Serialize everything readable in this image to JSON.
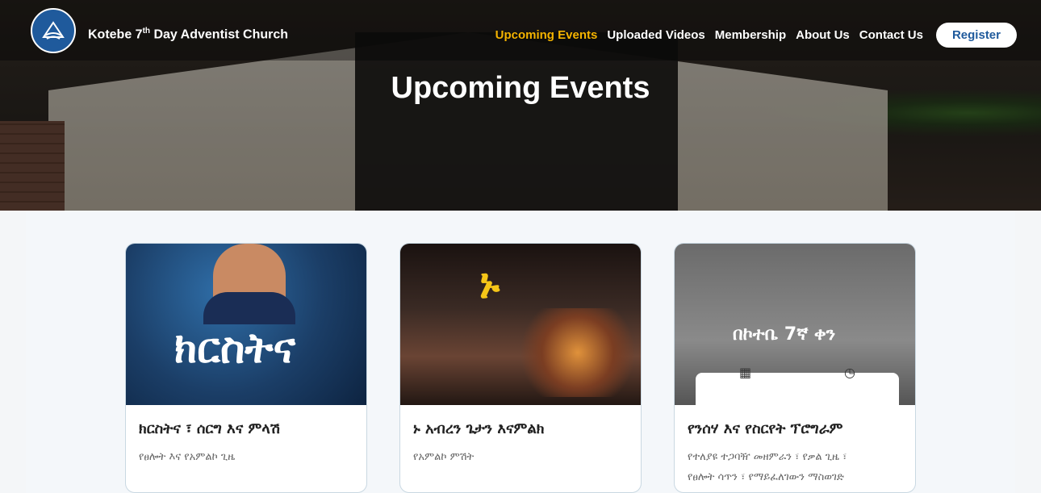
{
  "brand": {
    "name_prefix": "Kotebe 7",
    "name_sup": "th",
    "name_suffix": " Day Adventist Church"
  },
  "nav": {
    "items": [
      "Upcoming Events",
      "Uploaded Videos",
      "Membership",
      "About Us",
      "Contact Us"
    ],
    "active": "Upcoming Events",
    "register_label": "Register"
  },
  "page_title": "Upcoming Events",
  "colors": {
    "accent": "#f5b300",
    "brand": "#1f5a9c"
  },
  "events": [
    {
      "title": "ክርስትና ፣ ሰርግ እና ምላሽ",
      "description": "የፀሎት እና የአምልኮ ጊዜ",
      "poster_text": "ክርስትና"
    },
    {
      "title": "ኑ አብረን ጌታን እናምልክ",
      "description": "የአምልኮ ምሽት",
      "poster_text": "ኑ"
    },
    {
      "title": "የንሰሃ እና የስርየት ፕሮግራም",
      "description_line1": "የተለያዩ ተጋባዥ መዘምራን ፣ የቃል ጊዜ ፣",
      "description_line2": "የፀሎት ሳጥን ፣ የማይፈለገውን ማስወገድ",
      "poster_text": "በኮተቤ 7ኛ ቀን"
    }
  ]
}
